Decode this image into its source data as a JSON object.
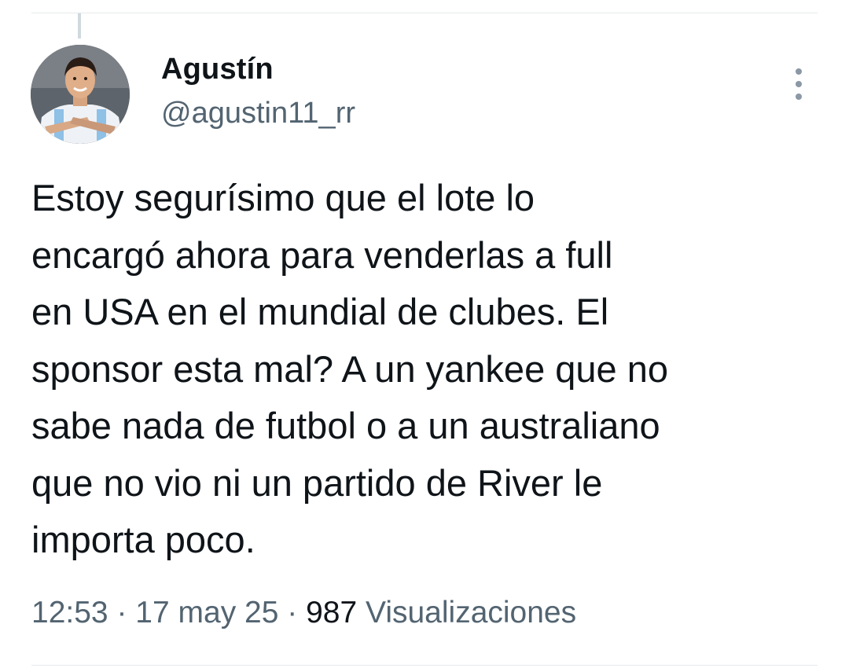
{
  "tweet": {
    "author_name": "Agustín",
    "author_handle": "@agustin11_rr",
    "avatar_icon": "profile-photo-icon",
    "more_icon": "more-options-icon",
    "text_lines": [
      "Estoy segurísimo que el lote lo",
      "encargó ahora para venderlas a full",
      "en USA en el mundial de clubes. El",
      "sponsor esta mal? A un yankee que no",
      "sabe nada de futbol o a un australiano",
      "que no vio ni un partido de River le",
      "importa poco."
    ],
    "time": "12:53",
    "separator": "·",
    "date": "17 may 25",
    "views_count": "987",
    "views_label": "Visualizaciones"
  },
  "colors": {
    "text_primary": "#0f1419",
    "text_secondary": "#536471",
    "divider": "#e7e9ea"
  }
}
